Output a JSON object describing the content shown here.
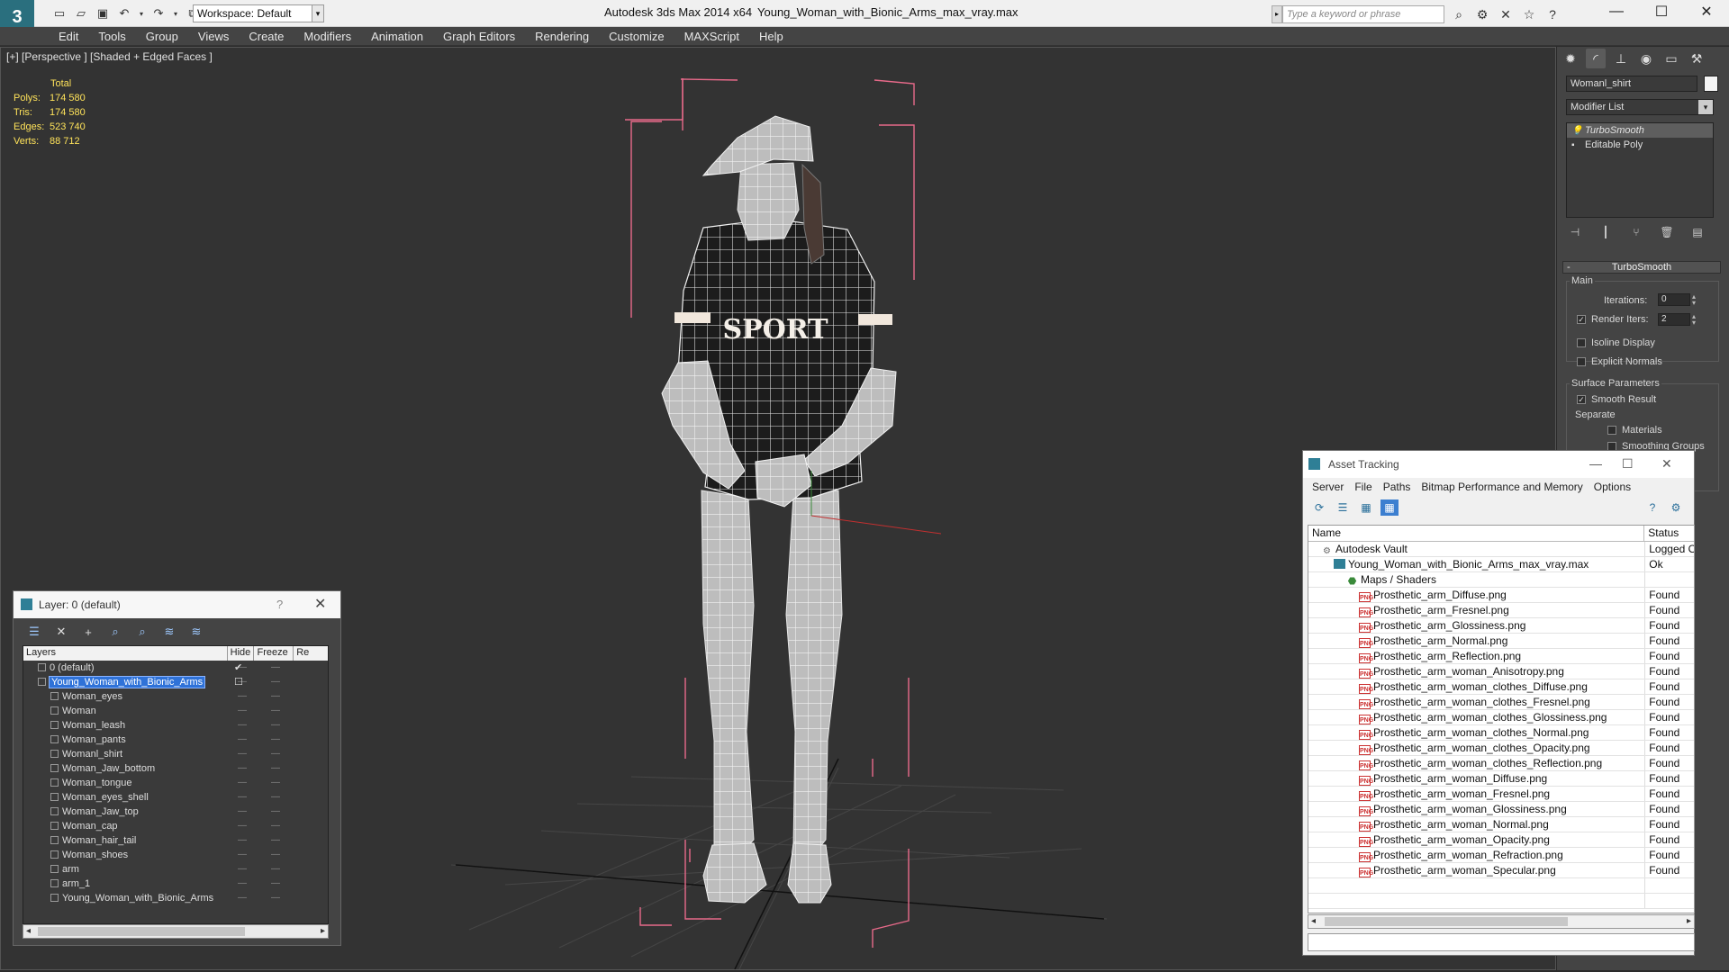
{
  "titlebar": {
    "workspace": "Workspace: Default",
    "app_title": "Autodesk 3ds Max  2014 x64",
    "file_title": "Young_Woman_with_Bionic_Arms_max_vray.max",
    "search_placeholder": "Type a keyword or phrase"
  },
  "menu": [
    "Edit",
    "Tools",
    "Group",
    "Views",
    "Create",
    "Modifiers",
    "Animation",
    "Graph Editors",
    "Rendering",
    "Customize",
    "MAXScript",
    "Help"
  ],
  "viewport": {
    "label": "[+] [Perspective ] [Shaded + Edged Faces ]",
    "stats": {
      "header": "Total",
      "rows": [
        {
          "label": "Polys:",
          "value": "174 580"
        },
        {
          "label": "Tris:",
          "value": "174 580"
        },
        {
          "label": "Edges:",
          "value": "523 740"
        },
        {
          "label": "Verts:",
          "value": "88 712"
        }
      ]
    },
    "model_text": "SPORT"
  },
  "command_panel": {
    "object_name": "Womanl_shirt",
    "modifier_list": "Modifier List",
    "stack": [
      "TurboSmooth",
      "Editable Poly"
    ],
    "rollout_title": "TurboSmooth",
    "main_label": "Main",
    "iterations_label": "Iterations:",
    "iterations_value": "0",
    "render_iters_label": "Render Iters:",
    "render_iters_value": "2",
    "render_iters_checked": true,
    "isoline_label": "Isoline Display",
    "explicit_normals_label": "Explicit Normals",
    "surface_label": "Surface Parameters",
    "smooth_result_label": "Smooth Result",
    "separate_label": "Separate",
    "materials_label": "Materials",
    "smoothing_groups_label": "Smoothing Groups"
  },
  "asset_tracking": {
    "title": "Asset Tracking",
    "menu": [
      "Server",
      "File",
      "Paths",
      "Bitmap Performance and Memory",
      "Options"
    ],
    "columns": {
      "name": "Name",
      "status": "Status"
    },
    "rows": [
      {
        "name": "Autodesk Vault",
        "status": "Logged O",
        "indent": 1,
        "icon": "vault"
      },
      {
        "name": "Young_Woman_with_Bionic_Arms_max_vray.max",
        "status": "Ok",
        "indent": 2,
        "icon": "file"
      },
      {
        "name": "Maps / Shaders",
        "status": "",
        "indent": 3,
        "icon": "folder"
      },
      {
        "name": "Prosthetic_arm_Diffuse.png",
        "status": "Found",
        "indent": 4,
        "icon": "png"
      },
      {
        "name": "Prosthetic_arm_Fresnel.png",
        "status": "Found",
        "indent": 4,
        "icon": "png"
      },
      {
        "name": "Prosthetic_arm_Glossiness.png",
        "status": "Found",
        "indent": 4,
        "icon": "png"
      },
      {
        "name": "Prosthetic_arm_Normal.png",
        "status": "Found",
        "indent": 4,
        "icon": "png"
      },
      {
        "name": "Prosthetic_arm_Reflection.png",
        "status": "Found",
        "indent": 4,
        "icon": "png"
      },
      {
        "name": "Prosthetic_arm_woman_Anisotropy.png",
        "status": "Found",
        "indent": 4,
        "icon": "png"
      },
      {
        "name": "Prosthetic_arm_woman_clothes_Diffuse.png",
        "status": "Found",
        "indent": 4,
        "icon": "png"
      },
      {
        "name": "Prosthetic_arm_woman_clothes_Fresnel.png",
        "status": "Found",
        "indent": 4,
        "icon": "png"
      },
      {
        "name": "Prosthetic_arm_woman_clothes_Glossiness.png",
        "status": "Found",
        "indent": 4,
        "icon": "png"
      },
      {
        "name": "Prosthetic_arm_woman_clothes_Normal.png",
        "status": "Found",
        "indent": 4,
        "icon": "png"
      },
      {
        "name": "Prosthetic_arm_woman_clothes_Opacity.png",
        "status": "Found",
        "indent": 4,
        "icon": "png"
      },
      {
        "name": "Prosthetic_arm_woman_clothes_Reflection.png",
        "status": "Found",
        "indent": 4,
        "icon": "png"
      },
      {
        "name": "Prosthetic_arm_woman_Diffuse.png",
        "status": "Found",
        "indent": 4,
        "icon": "png"
      },
      {
        "name": "Prosthetic_arm_woman_Fresnel.png",
        "status": "Found",
        "indent": 4,
        "icon": "png"
      },
      {
        "name": "Prosthetic_arm_woman_Glossiness.png",
        "status": "Found",
        "indent": 4,
        "icon": "png"
      },
      {
        "name": "Prosthetic_arm_woman_Normal.png",
        "status": "Found",
        "indent": 4,
        "icon": "png"
      },
      {
        "name": "Prosthetic_arm_woman_Opacity.png",
        "status": "Found",
        "indent": 4,
        "icon": "png"
      },
      {
        "name": "Prosthetic_arm_woman_Refraction.png",
        "status": "Found",
        "indent": 4,
        "icon": "png"
      },
      {
        "name": "Prosthetic_arm_woman_Specular.png",
        "status": "Found",
        "indent": 4,
        "icon": "png"
      }
    ]
  },
  "layer_window": {
    "title": "Layer: 0 (default)",
    "help": "?",
    "columns": {
      "layers": "Layers",
      "hide": "Hide",
      "freeze": "Freeze",
      "render": "Re"
    },
    "rows": [
      {
        "name": "0 (default)",
        "level": 0,
        "selected": false,
        "checked": true
      },
      {
        "name": "Young_Woman_with_Bionic_Arms",
        "level": 0,
        "selected": true,
        "checked": false
      },
      {
        "name": "Woman_eyes",
        "level": 1
      },
      {
        "name": "Woman",
        "level": 1
      },
      {
        "name": "Woman_leash",
        "level": 1
      },
      {
        "name": "Woman_pants",
        "level": 1
      },
      {
        "name": "Womanl_shirt",
        "level": 1
      },
      {
        "name": "Woman_Jaw_bottom",
        "level": 1
      },
      {
        "name": "Woman_tongue",
        "level": 1
      },
      {
        "name": "Woman_eyes_shell",
        "level": 1
      },
      {
        "name": "Woman_Jaw_top",
        "level": 1
      },
      {
        "name": "Woman_cap",
        "level": 1
      },
      {
        "name": "Woman_hair_tail",
        "level": 1
      },
      {
        "name": "Woman_shoes",
        "level": 1
      },
      {
        "name": "arm",
        "level": 1
      },
      {
        "name": "arm_1",
        "level": 1
      },
      {
        "name": "Young_Woman_with_Bionic_Arms",
        "level": 1
      }
    ]
  },
  "colors": {
    "viewport_bg": "#333333",
    "selection_bracket": "#e86a8a",
    "stats_text": "#ffe35a",
    "selection_blue": "#2f72d8"
  }
}
